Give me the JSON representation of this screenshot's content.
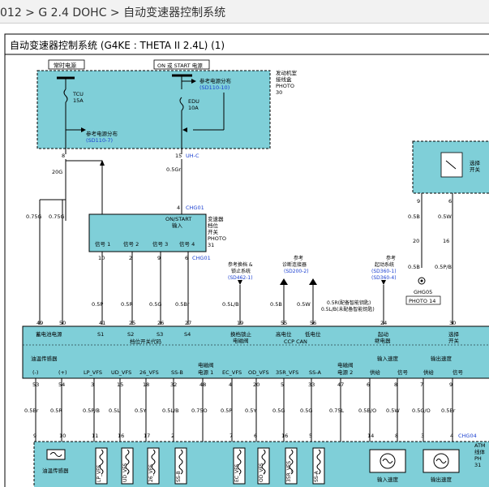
{
  "breadcrumb": "012 > G 2.4 DOHC > 自动变速器控制系统",
  "title": "自动变速器控制系统 (G4KE : THETA II 2.4L) (1)",
  "colors": {
    "module_fill": "#7fcfd8",
    "line": "#000000",
    "blue_text": "#1a3fd0",
    "wire": "#000000"
  },
  "fuse_box": {
    "label_constant": "常时电源",
    "label_on_start": "ON 或 START 电源",
    "tcu_fuse": "TCU\n15A",
    "tcu_name": "TCU",
    "tcu_amp": "15A",
    "edu_name": "EDU",
    "edu_amp": "10A",
    "ref_left": "参考电源分布",
    "ref_left_code": "(SD110-7)",
    "ref_right": "参考电源分布",
    "ref_right_code": "(SD110-10)",
    "box_name_1": "发动机室",
    "box_name_2": "接线盒",
    "box_photo": "PHOTO",
    "box_photo_num": "30",
    "pin_left": "8",
    "pin_right": "15",
    "conn_right": "UH-C"
  },
  "wires_top": {
    "left_color": "20G",
    "right_color": "0.5Gr",
    "chg01_pin": "4",
    "chg01": "CHG01"
  },
  "inhibitor": {
    "title_1": "ON/START",
    "title_2": "输入",
    "name_1": "变速器",
    "name_2": "档位",
    "name_3": "开关",
    "photo": "PHOTO",
    "photo_num": "31",
    "signals": [
      "信号 1",
      "信号 2",
      "信号 3",
      "信号 4"
    ],
    "conn": "CHG01",
    "pins": [
      "10",
      "2",
      "9",
      "6"
    ]
  },
  "wire_colors_mid": [
    "0.5P",
    "0.5R",
    "0.5G",
    "0.5Br"
  ],
  "left_wires": [
    "0.75G",
    "0.75G"
  ],
  "refs_mid": {
    "anti_theft_1": "参考换档 &",
    "anti_theft_2": "锁止系统",
    "anti_theft_code": "(SD462-1)",
    "ccp_1": "参考",
    "ccp_2": "诊断连接器",
    "ccp_code": "(SD200-2)",
    "start_1": "参考",
    "start_2": "起动系统",
    "start_code_1": "(SD360-1)",
    "start_code_2": "(SD360-4)"
  },
  "mid_wires": {
    "lock": "0.5L/B",
    "ccp_h": "0.5B",
    "ccp_l": "0.5W",
    "start_1": "0.5R(配备智能钥匙)",
    "start_2": "0.5L/B(未配备智能钥匙)"
  },
  "right_switch": {
    "name_1": "选择",
    "name_2": "开关",
    "pin_a": "9",
    "pin_b": "6",
    "wire_a": "0.5B",
    "wire_b": "0.5W",
    "pin_c": "20",
    "pin_d": "16",
    "wire_c": "0.5B",
    "wire_d": "0.5P/B",
    "ground": "GHG05",
    "photo": "PHOTO 14"
  },
  "tcm_pins_top": [
    "49",
    "50",
    "41",
    "25",
    "26",
    "27",
    "19",
    "55",
    "56",
    "24",
    "30"
  ],
  "tcm_labels_top": {
    "battery": "蓄电池电源",
    "s1": "S1",
    "s2": "S2",
    "s3": "S3",
    "s4": "S4",
    "gear_code": "档位开关代码",
    "lock_1": "换档锁止",
    "lock_2": "电磁阀",
    "high": "高电位",
    "low": "低电位",
    "ccp": "CCP CAN",
    "start_1": "起动",
    "start_2": "继电器",
    "select_1": "选择",
    "select_2": "开关"
  },
  "tcm_labels_bottom": {
    "oil_temp": "油温传感器",
    "minus": "(-)",
    "plus": "(+)",
    "sol_power_1": "电磁阀",
    "sol_power_2": "电源 1",
    "sol_power2_1": "电磁阀",
    "sol_power2_2": "电源 2",
    "input_speed": "输入速度",
    "output_speed": "输出速度",
    "supply": "供给",
    "signal": "信号",
    "vfs": [
      "LP_VFS",
      "UD_VFS",
      "26_VFS",
      "SS-B",
      "EC_VFS",
      "OD_VFS",
      "35R_VFS",
      "SS-A"
    ]
  },
  "tcm_pins_bottom": [
    "53",
    "54",
    "3",
    "15",
    "18",
    "32",
    "48",
    "4",
    "20",
    "5",
    "33",
    "47",
    "6",
    "8",
    "7",
    "9"
  ],
  "wires_bottom": [
    "0.5Br",
    "0.5R",
    "0.5P/B",
    "0.5L",
    "0.5Y",
    "0.5L/B",
    "0.75O",
    "0.5P",
    "0.5Y",
    "0.5G",
    "0.5G",
    "0.75L",
    "0.5B/O",
    "0.5W",
    "0.5G/O",
    "0.5Br"
  ],
  "atm_pins": [
    "9",
    "10",
    "11",
    "16",
    "17",
    "2",
    "7",
    "6",
    "16",
    "5",
    "14",
    "8",
    "3",
    "4"
  ],
  "atm_labels": {
    "oil_sensor": "油温传感器",
    "input_speed": "输入速度",
    "output_speed": "输出速度",
    "conn": "CHG04",
    "atm_1": "ATM",
    "atm_2": "线体",
    "atm_3": "PH",
    "atm_4": "31"
  }
}
